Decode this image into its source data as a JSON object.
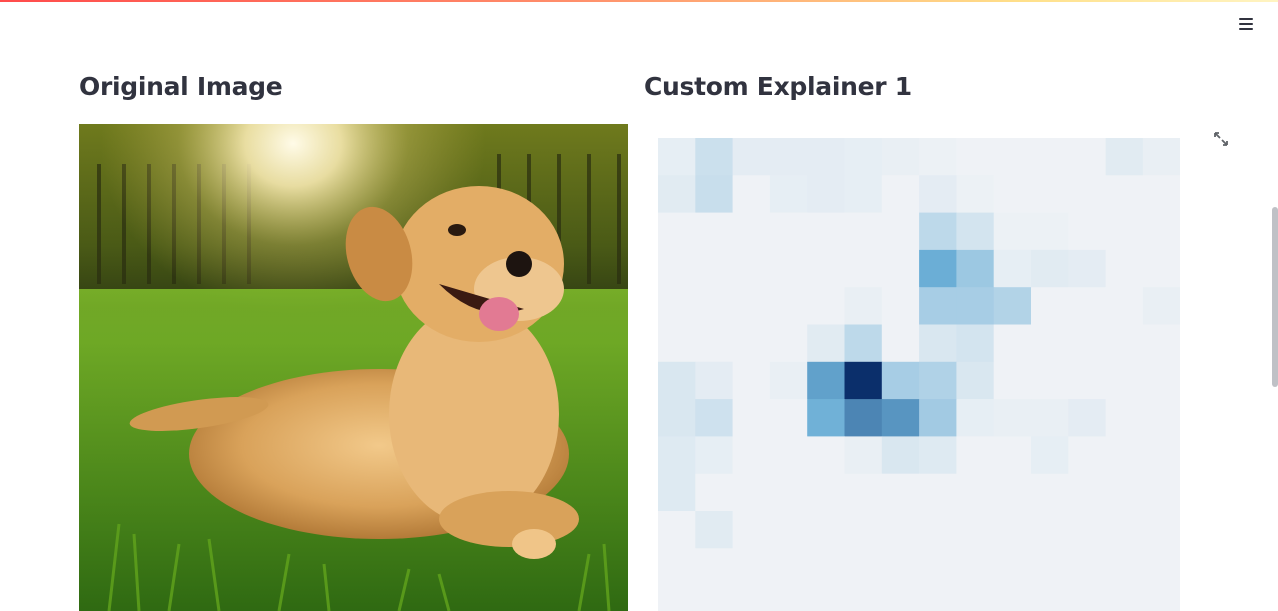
{
  "header": {
    "menu_icon": "hamburger-menu-icon",
    "accent_gradient": [
      "#ff4b4b",
      "#ffe08a"
    ]
  },
  "columns": {
    "left": {
      "title": "Original Image"
    },
    "right": {
      "title": "Custom Explainer 1",
      "expand_icon": "fullscreen-expand-icon"
    }
  },
  "heatmap": {
    "colormap": "Blues",
    "low_color": "#f4f5f7",
    "high_color": "#0b2f6b",
    "grid": [
      [
        0.05,
        0.15,
        0.06,
        0.06,
        0.06,
        0.05,
        0.04,
        0.03,
        0.02,
        0.02,
        0.02,
        0.02,
        0.07,
        0.04
      ],
      [
        0.07,
        0.16,
        0.02,
        0.05,
        0.06,
        0.05,
        0.02,
        0.06,
        0.03,
        0.02,
        0.02,
        0.02,
        0.02,
        0.02
      ],
      [
        0.02,
        0.02,
        0.02,
        0.02,
        0.02,
        0.02,
        0.02,
        0.2,
        0.12,
        0.03,
        0.03,
        0.02,
        0.02,
        0.02
      ],
      [
        0.02,
        0.02,
        0.02,
        0.02,
        0.02,
        0.02,
        0.02,
        0.5,
        0.32,
        0.05,
        0.07,
        0.06,
        0.02,
        0.02
      ],
      [
        0.02,
        0.02,
        0.02,
        0.02,
        0.02,
        0.04,
        0.02,
        0.28,
        0.28,
        0.24,
        0.02,
        0.02,
        0.02,
        0.04
      ],
      [
        0.02,
        0.02,
        0.02,
        0.02,
        0.07,
        0.2,
        0.02,
        0.1,
        0.12,
        0.02,
        0.02,
        0.02,
        0.02,
        0.02
      ],
      [
        0.1,
        0.06,
        0.02,
        0.04,
        0.55,
        1.0,
        0.28,
        0.25,
        0.1,
        0.02,
        0.02,
        0.02,
        0.02,
        0.02
      ],
      [
        0.1,
        0.14,
        0.02,
        0.02,
        0.48,
        0.66,
        0.6,
        0.3,
        0.05,
        0.04,
        0.04,
        0.06,
        0.02,
        0.02
      ],
      [
        0.08,
        0.05,
        0.02,
        0.02,
        0.02,
        0.04,
        0.1,
        0.08,
        0.02,
        0.02,
        0.05,
        0.02,
        0.02,
        0.02
      ],
      [
        0.08,
        0.02,
        0.02,
        0.02,
        0.02,
        0.02,
        0.02,
        0.02,
        0.02,
        0.02,
        0.02,
        0.02,
        0.02,
        0.02
      ],
      [
        0.02,
        0.07,
        0.02,
        0.02,
        0.02,
        0.02,
        0.02,
        0.02,
        0.02,
        0.02,
        0.02,
        0.02,
        0.02,
        0.02
      ],
      [
        0.02,
        0.02,
        0.02,
        0.02,
        0.02,
        0.02,
        0.02,
        0.02,
        0.02,
        0.02,
        0.02,
        0.02,
        0.02,
        0.02
      ],
      [
        0.02,
        0.02,
        0.02,
        0.02,
        0.02,
        0.02,
        0.02,
        0.02,
        0.02,
        0.02,
        0.02,
        0.02,
        0.02,
        0.02
      ]
    ]
  }
}
